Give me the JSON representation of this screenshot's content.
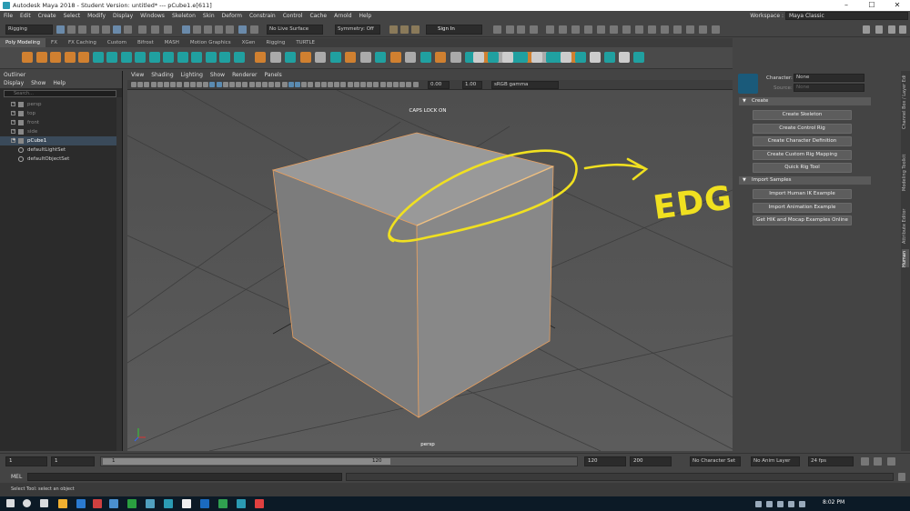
{
  "window": {
    "title": "Autodesk Maya 2018 - Student Version: untitled*  ---  pCube1.e[611]",
    "minimize": "–",
    "maximize": "☐",
    "close": "✕"
  },
  "menubar": [
    "File",
    "Edit",
    "Create",
    "Select",
    "Modify",
    "Display",
    "Windows",
    "Skeleton",
    "Skin",
    "Deform",
    "Constrain",
    "Control",
    "Cache",
    "Arnold",
    "Help"
  ],
  "workspace": {
    "label": "Workspace :",
    "value": "Maya Classic"
  },
  "statusline": {
    "mode": "Rigging",
    "live_surface": "No Live Surface",
    "symmetry": "Symmetry: Off",
    "sign_in": "Sign In"
  },
  "shelf_tabs": [
    "Poly Modeling",
    "FX",
    "FX Caching",
    "Custom",
    "Bifrost",
    "MASH",
    "Motion Graphics",
    "XGen",
    "Rigging",
    "TURTLE"
  ],
  "outliner": {
    "title": "Outliner",
    "menu": [
      "Display",
      "Show",
      "Help"
    ],
    "search_placeholder": "Search...",
    "items": [
      {
        "label": "persp",
        "hidden": true
      },
      {
        "label": "top",
        "hidden": true
      },
      {
        "label": "front",
        "hidden": true
      },
      {
        "label": "side",
        "hidden": true
      },
      {
        "label": "pCube1",
        "hidden": false
      },
      {
        "label": "defaultLightSet",
        "hidden": false
      },
      {
        "label": "defaultObjectSet",
        "hidden": false
      }
    ]
  },
  "viewport": {
    "menu": [
      "View",
      "Shading",
      "Lighting",
      "Show",
      "Renderer",
      "Panels"
    ],
    "exposure": "0.00",
    "gamma": "1.00",
    "color_space": "sRGB gamma",
    "caps_lock": "CAPS LOCK ON",
    "camera": "persp",
    "annotation": "EDGE"
  },
  "human_ik": {
    "character_label": "Character:",
    "character_value": "None",
    "source_label": "Source:",
    "source_value": "None",
    "create_section": "Create",
    "create_buttons": [
      "Create Skeleton",
      "Create Control Rig",
      "Create Character Definition",
      "Create Custom Rig Mapping",
      "Quick Rig Tool"
    ],
    "import_section": "Import Samples",
    "import_buttons": [
      "Import Human IK Example",
      "Import Animation Example",
      "Get HIK and Mocap Examples Online"
    ]
  },
  "side_tabs": [
    "Channel Box / Layer Editor",
    "Modeling Toolkit",
    "Attribute Editor",
    "Human IK"
  ],
  "timeline": {
    "start": "1",
    "range_start": "1",
    "range_start_num": "1",
    "range_end_num": "120",
    "end": "120",
    "anim_end": "200",
    "character_set": "No Character Set",
    "anim_layer": "No Anim Layer",
    "fps": "24 fps"
  },
  "command_line": {
    "label": "MEL"
  },
  "help_line": "Select Tool: select an object",
  "taskbar": {
    "time": "8:02 PM"
  },
  "colors": {
    "cube_face": "#8a8a8a",
    "selection": "#e8a060",
    "annotation": "#f0e020"
  }
}
